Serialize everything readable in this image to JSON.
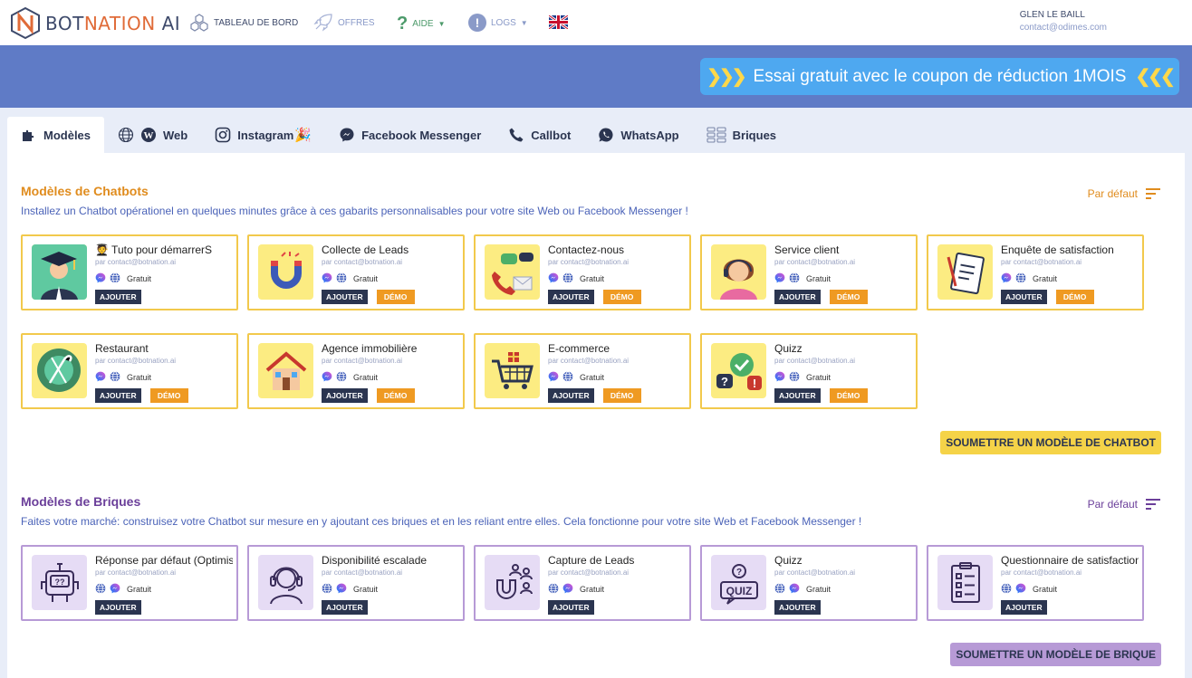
{
  "app": {
    "brand_left": "BOT",
    "brand_mid": "NATION",
    "brand_right": " AI"
  },
  "nav": {
    "dashboard": "TABLEAU DE BORD",
    "offres": "OFFRES",
    "aide": "AIDE",
    "logs": "LOGS"
  },
  "user": {
    "name": "GLEN LE BAILL",
    "email": "contact@odimes.com"
  },
  "promo": {
    "text": "Essai gratuit avec le coupon de réduction 1MOIS"
  },
  "tabs": [
    {
      "label": "Modèles"
    },
    {
      "label": "Web"
    },
    {
      "label": "Instagram"
    },
    {
      "label": "Facebook Messenger"
    },
    {
      "label": "Callbot"
    },
    {
      "label": "WhatsApp"
    },
    {
      "label": "Briques"
    }
  ],
  "chatbots": {
    "title": "Modèles de Chatbots",
    "subtitle": "Installez un Chatbot opérationel en quelques minutes grâce à ces gabarits personnalisables pour votre site Web ou Facebook Messenger !",
    "sort_label": "Par défaut",
    "submit_label": "SOUMETTRE UN MODÈLE DE CHATBOT",
    "author": "par contact@botnation.ai",
    "price": "Gratuit",
    "add_label": "AJOUTER",
    "demo_label": "DÉMO",
    "items": [
      {
        "name": "🧑‍🎓 Tuto pour démarrerS",
        "icon": "graduate-icon"
      },
      {
        "name": "Collecte de Leads",
        "icon": "magnet-icon"
      },
      {
        "name": "Contactez-nous",
        "icon": "phone-mail-icon"
      },
      {
        "name": "Service client",
        "icon": "support-agent-icon"
      },
      {
        "name": "Enquête de satisfaction",
        "icon": "clipboard-icon"
      },
      {
        "name": "Restaurant",
        "icon": "plate-icon"
      },
      {
        "name": "Agence immobilière",
        "icon": "house-icon"
      },
      {
        "name": "E-commerce",
        "icon": "cart-icon"
      },
      {
        "name": "Quizz",
        "icon": "quiz-bubbles-icon"
      }
    ]
  },
  "briques": {
    "title": "Modèles de Briques",
    "subtitle": "Faites votre marché: construisez votre Chatbot sur mesure en y ajoutant ces briques et en les reliant entre elles. Cela fonctionne pour votre site Web et Facebook Messenger !",
    "sort_label": "Par défaut",
    "submit_label": "SOUMETTRE UN MODÈLE DE BRIQUE",
    "author": "par contact@botnation.ai",
    "price": "Gratuit",
    "add_label": "AJOUTER",
    "items": [
      {
        "name": "Réponse par défaut (Optimisée)",
        "icon": "robot-icon"
      },
      {
        "name": "Disponibilité escalade",
        "icon": "headset-agent-icon"
      },
      {
        "name": "Capture de Leads",
        "icon": "magnet-users-icon"
      },
      {
        "name": "Quizz",
        "icon": "quiz-icon"
      },
      {
        "name": "Questionnaire de satisfaction",
        "icon": "checklist-icon"
      }
    ]
  },
  "colors": {
    "chatbot_title": "#e08c1e",
    "brique_title": "#6b3f9a",
    "chatbot_border": "#f2c94c",
    "brique_border": "#b79ad6",
    "banner": "#5f7bc6",
    "promo": "#4ea8f0"
  }
}
